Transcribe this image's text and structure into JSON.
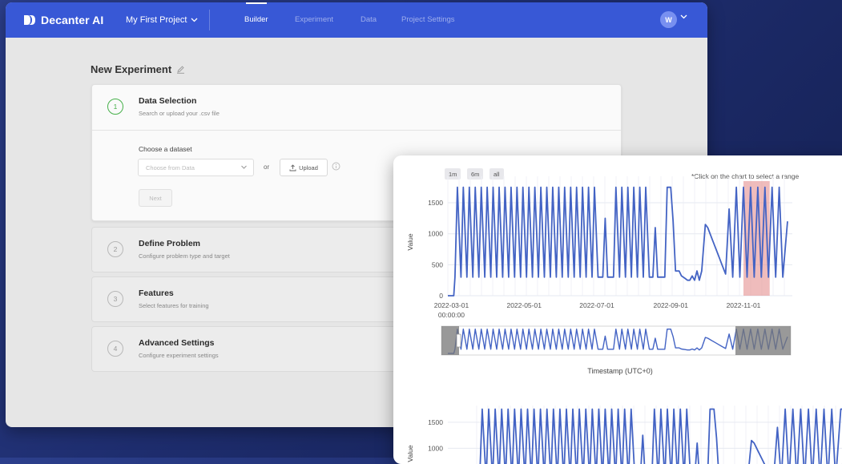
{
  "app": {
    "brand_name": "Decanter AI",
    "project_name": "My First Project",
    "nav_tabs": [
      {
        "label": "Builder",
        "active": true
      },
      {
        "label": "Experiment",
        "active": false
      },
      {
        "label": "Data",
        "active": false
      },
      {
        "label": "Project Settings",
        "active": false
      }
    ],
    "avatar_initial": "W",
    "colors": {
      "topbar": "#3858d6",
      "step_active": "#46b04a"
    }
  },
  "page": {
    "title": "New Experiment"
  },
  "steps": [
    {
      "number": "1",
      "title": "Data Selection",
      "subtitle": "Search or upload your .csv file"
    },
    {
      "number": "2",
      "title": "Define Problem",
      "subtitle": "Configure problem type and target"
    },
    {
      "number": "3",
      "title": "Features",
      "subtitle": "Select features for training"
    },
    {
      "number": "4",
      "title": "Advanced Settings",
      "subtitle": "Configure experiment settings"
    }
  ],
  "data_selection": {
    "choose_label": "Choose a dataset",
    "select_placeholder": "Choose from Data",
    "or_text": "or",
    "upload_label": "Upload",
    "next_label": "Next"
  },
  "chart_panel": {
    "range_buttons": [
      "1m",
      "6m",
      "all"
    ],
    "hint": "*Click on the chart to select a range"
  },
  "chart_data": [
    {
      "type": "line",
      "ylabel": "Value",
      "xlabel": "Timestamp (UTC+0)",
      "yticks": [
        "0",
        "500",
        "1000",
        "1500"
      ],
      "xticks": [
        {
          "label": "2022-03-01",
          "sublabel": "00:00:00"
        },
        {
          "label": "2022-05-01"
        },
        {
          "label": "2022-07-01"
        },
        {
          "label": "2022-09-01"
        },
        {
          "label": "2022-11-01"
        }
      ],
      "ylim": [
        0,
        1850
      ],
      "xrange": [
        "2022-02-26",
        "2022-12-12"
      ],
      "selected_range": [
        "2022-11-01",
        "2022-11-23"
      ],
      "line_color": "#4363c4",
      "selection_color": "#e58f8f",
      "series": [
        {
          "values": [
            [
              "2022-02-26",
              0
            ],
            [
              "2022-03-03",
              0
            ],
            [
              "2022-03-04",
              300
            ],
            [
              "2022-03-06",
              1750
            ],
            [
              "2022-03-09",
              300
            ],
            [
              "2022-03-11",
              1750
            ],
            [
              "2022-03-14",
              300
            ],
            [
              "2022-03-16",
              1750
            ],
            [
              "2022-03-19",
              300
            ],
            [
              "2022-03-21",
              1750
            ],
            [
              "2022-03-24",
              300
            ],
            [
              "2022-03-26",
              1750
            ],
            [
              "2022-03-29",
              300
            ],
            [
              "2022-03-31",
              1750
            ],
            [
              "2022-04-03",
              300
            ],
            [
              "2022-04-05",
              1750
            ],
            [
              "2022-04-08",
              300
            ],
            [
              "2022-04-10",
              1750
            ],
            [
              "2022-04-13",
              300
            ],
            [
              "2022-04-15",
              1750
            ],
            [
              "2022-04-18",
              300
            ],
            [
              "2022-04-20",
              1750
            ],
            [
              "2022-04-23",
              300
            ],
            [
              "2022-04-25",
              1750
            ],
            [
              "2022-04-28",
              300
            ],
            [
              "2022-04-30",
              1750
            ],
            [
              "2022-05-03",
              300
            ],
            [
              "2022-05-05",
              1750
            ],
            [
              "2022-05-08",
              300
            ],
            [
              "2022-05-10",
              1750
            ],
            [
              "2022-05-13",
              300
            ],
            [
              "2022-05-15",
              1750
            ],
            [
              "2022-05-18",
              300
            ],
            [
              "2022-05-20",
              1750
            ],
            [
              "2022-05-23",
              300
            ],
            [
              "2022-05-25",
              1750
            ],
            [
              "2022-05-28",
              300
            ],
            [
              "2022-05-30",
              1750
            ],
            [
              "2022-06-02",
              300
            ],
            [
              "2022-06-04",
              1750
            ],
            [
              "2022-06-07",
              300
            ],
            [
              "2022-06-09",
              1750
            ],
            [
              "2022-06-12",
              300
            ],
            [
              "2022-06-14",
              1750
            ],
            [
              "2022-06-17",
              300
            ],
            [
              "2022-06-19",
              1750
            ],
            [
              "2022-06-22",
              300
            ],
            [
              "2022-06-24",
              1750
            ],
            [
              "2022-06-27",
              300
            ],
            [
              "2022-06-29",
              1750
            ],
            [
              "2022-07-02",
              300
            ],
            [
              "2022-07-04",
              300
            ],
            [
              "2022-07-06",
              300
            ],
            [
              "2022-07-08",
              1250
            ],
            [
              "2022-07-10",
              300
            ],
            [
              "2022-07-12",
              300
            ],
            [
              "2022-07-15",
              300
            ],
            [
              "2022-07-17",
              1750
            ],
            [
              "2022-07-20",
              300
            ],
            [
              "2022-07-22",
              1750
            ],
            [
              "2022-07-25",
              300
            ],
            [
              "2022-07-27",
              1750
            ],
            [
              "2022-07-30",
              300
            ],
            [
              "2022-08-01",
              1750
            ],
            [
              "2022-08-04",
              300
            ],
            [
              "2022-08-06",
              1750
            ],
            [
              "2022-08-09",
              300
            ],
            [
              "2022-08-11",
              1750
            ],
            [
              "2022-08-14",
              300
            ],
            [
              "2022-08-17",
              300
            ],
            [
              "2022-08-19",
              1100
            ],
            [
              "2022-08-21",
              300
            ],
            [
              "2022-08-24",
              300
            ],
            [
              "2022-08-27",
              300
            ],
            [
              "2022-08-29",
              1750
            ],
            [
              "2022-09-01",
              1750
            ],
            [
              "2022-09-03",
              1200
            ],
            [
              "2022-09-05",
              400
            ],
            [
              "2022-09-08",
              400
            ],
            [
              "2022-09-10",
              320
            ],
            [
              "2022-09-13",
              280
            ],
            [
              "2022-09-15",
              250
            ],
            [
              "2022-09-17",
              250
            ],
            [
              "2022-09-19",
              320
            ],
            [
              "2022-09-21",
              250
            ],
            [
              "2022-09-23",
              400
            ],
            [
              "2022-09-25",
              250
            ],
            [
              "2022-09-27",
              400
            ],
            [
              "2022-09-30",
              1150
            ],
            [
              "2022-10-02",
              1100
            ],
            [
              "2022-10-05",
              950
            ],
            [
              "2022-10-08",
              800
            ],
            [
              "2022-10-11",
              650
            ],
            [
              "2022-10-14",
              500
            ],
            [
              "2022-10-17",
              350
            ],
            [
              "2022-10-20",
              1400
            ],
            [
              "2022-10-23",
              300
            ],
            [
              "2022-10-26",
              1750
            ],
            [
              "2022-10-29",
              300
            ],
            [
              "2022-11-01",
              1750
            ],
            [
              "2022-11-04",
              300
            ],
            [
              "2022-11-07",
              1750
            ],
            [
              "2022-11-10",
              300
            ],
            [
              "2022-11-13",
              1750
            ],
            [
              "2022-11-16",
              300
            ],
            [
              "2022-11-19",
              1750
            ],
            [
              "2022-11-22",
              300
            ],
            [
              "2022-11-25",
              1750
            ],
            [
              "2022-11-28",
              300
            ],
            [
              "2022-12-01",
              1750
            ],
            [
              "2022-12-04",
              300
            ],
            [
              "2022-12-08",
              1200
            ]
          ]
        }
      ]
    },
    {
      "type": "line",
      "ylabel": "Value",
      "yticks": [
        "1000",
        "1500"
      ],
      "ylim": [
        700,
        1850
      ],
      "xrange": [
        "2022-02-26",
        "2022-12-12"
      ],
      "line_color": "#4363c4",
      "series": [
        {
          "values": [
            [
              "2022-02-26",
              0
            ],
            [
              "2022-03-03",
              0
            ],
            [
              "2022-03-04",
              300
            ],
            [
              "2022-03-06",
              1750
            ],
            [
              "2022-03-09",
              300
            ],
            [
              "2022-03-11",
              1750
            ],
            [
              "2022-03-14",
              300
            ],
            [
              "2022-03-16",
              1750
            ],
            [
              "2022-03-19",
              300
            ],
            [
              "2022-03-21",
              1750
            ],
            [
              "2022-03-24",
              300
            ],
            [
              "2022-03-26",
              1750
            ],
            [
              "2022-03-29",
              300
            ],
            [
              "2022-03-31",
              1750
            ],
            [
              "2022-04-03",
              300
            ],
            [
              "2022-04-05",
              1750
            ],
            [
              "2022-04-08",
              300
            ],
            [
              "2022-04-10",
              1750
            ],
            [
              "2022-04-13",
              300
            ],
            [
              "2022-04-15",
              1750
            ],
            [
              "2022-04-18",
              300
            ],
            [
              "2022-04-20",
              1750
            ],
            [
              "2022-04-23",
              300
            ],
            [
              "2022-04-25",
              1750
            ],
            [
              "2022-04-28",
              300
            ],
            [
              "2022-04-30",
              1750
            ],
            [
              "2022-05-03",
              300
            ],
            [
              "2022-05-05",
              1750
            ],
            [
              "2022-05-08",
              300
            ],
            [
              "2022-05-10",
              1750
            ],
            [
              "2022-05-13",
              300
            ],
            [
              "2022-05-15",
              1750
            ],
            [
              "2022-05-18",
              300
            ],
            [
              "2022-05-20",
              1750
            ],
            [
              "2022-05-23",
              300
            ],
            [
              "2022-05-25",
              1750
            ],
            [
              "2022-05-28",
              300
            ],
            [
              "2022-05-30",
              1750
            ],
            [
              "2022-06-02",
              300
            ],
            [
              "2022-06-04",
              1750
            ],
            [
              "2022-06-07",
              300
            ],
            [
              "2022-06-09",
              1750
            ],
            [
              "2022-06-12",
              300
            ],
            [
              "2022-06-14",
              1750
            ],
            [
              "2022-06-17",
              300
            ],
            [
              "2022-06-19",
              1750
            ],
            [
              "2022-06-22",
              300
            ],
            [
              "2022-06-24",
              1750
            ],
            [
              "2022-06-27",
              300
            ],
            [
              "2022-06-29",
              1750
            ],
            [
              "2022-07-02",
              300
            ],
            [
              "2022-07-04",
              300
            ],
            [
              "2022-07-06",
              300
            ],
            [
              "2022-07-08",
              1250
            ],
            [
              "2022-07-10",
              300
            ],
            [
              "2022-07-12",
              300
            ],
            [
              "2022-07-15",
              300
            ],
            [
              "2022-07-17",
              1750
            ],
            [
              "2022-07-20",
              300
            ],
            [
              "2022-07-22",
              1750
            ],
            [
              "2022-07-25",
              300
            ],
            [
              "2022-07-27",
              1750
            ],
            [
              "2022-07-30",
              300
            ],
            [
              "2022-08-01",
              1750
            ],
            [
              "2022-08-04",
              300
            ],
            [
              "2022-08-06",
              1750
            ],
            [
              "2022-08-09",
              300
            ],
            [
              "2022-08-11",
              1750
            ],
            [
              "2022-08-14",
              300
            ],
            [
              "2022-08-17",
              300
            ],
            [
              "2022-08-19",
              1100
            ],
            [
              "2022-08-21",
              300
            ],
            [
              "2022-08-24",
              300
            ],
            [
              "2022-08-27",
              300
            ],
            [
              "2022-08-29",
              1750
            ],
            [
              "2022-09-01",
              1750
            ],
            [
              "2022-09-03",
              1200
            ],
            [
              "2022-09-05",
              400
            ],
            [
              "2022-09-08",
              400
            ],
            [
              "2022-09-10",
              320
            ],
            [
              "2022-09-13",
              280
            ],
            [
              "2022-09-15",
              250
            ],
            [
              "2022-09-17",
              250
            ],
            [
              "2022-09-19",
              320
            ],
            [
              "2022-09-21",
              250
            ],
            [
              "2022-09-23",
              400
            ],
            [
              "2022-09-25",
              250
            ],
            [
              "2022-09-27",
              400
            ],
            [
              "2022-09-30",
              1150
            ],
            [
              "2022-10-02",
              1100
            ],
            [
              "2022-10-05",
              950
            ],
            [
              "2022-10-08",
              800
            ],
            [
              "2022-10-11",
              650
            ],
            [
              "2022-10-14",
              500
            ],
            [
              "2022-10-17",
              350
            ],
            [
              "2022-10-20",
              1400
            ],
            [
              "2022-10-23",
              300
            ],
            [
              "2022-10-26",
              1750
            ],
            [
              "2022-10-29",
              300
            ],
            [
              "2022-11-01",
              1750
            ],
            [
              "2022-11-04",
              300
            ],
            [
              "2022-11-07",
              1750
            ],
            [
              "2022-11-10",
              300
            ],
            [
              "2022-11-13",
              1750
            ],
            [
              "2022-11-16",
              300
            ],
            [
              "2022-11-19",
              1750
            ],
            [
              "2022-11-22",
              300
            ],
            [
              "2022-11-25",
              1750
            ],
            [
              "2022-11-28",
              300
            ],
            [
              "2022-12-01",
              1750
            ],
            [
              "2022-12-04",
              300
            ],
            [
              "2022-12-08",
              1750
            ],
            [
              "2022-12-12",
              1750
            ]
          ]
        }
      ]
    }
  ]
}
